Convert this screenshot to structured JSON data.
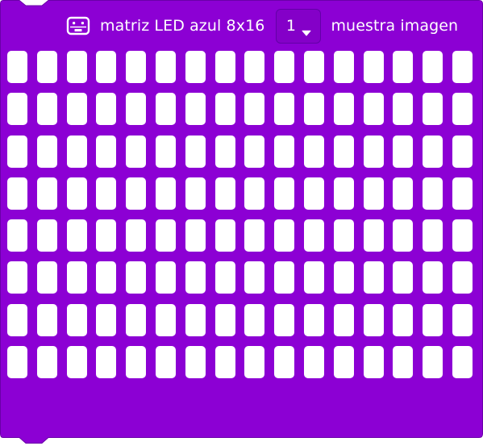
{
  "block": {
    "title": "matriz LED azul 8x16",
    "dropdown_value": "1",
    "trailing_text": "muestra imagen",
    "icon": "robot-board-icon",
    "colors": {
      "block_fill": "#8c00d4",
      "block_border": "#6a00a8",
      "led_off": "#ffffff",
      "led_on": "#1d3fe0"
    }
  },
  "matrix": {
    "rows": 8,
    "cols": 16,
    "cells": [
      [
        0,
        0,
        0,
        0,
        0,
        0,
        0,
        0,
        0,
        0,
        0,
        0,
        0,
        0,
        0,
        0
      ],
      [
        0,
        0,
        0,
        0,
        0,
        0,
        0,
        0,
        0,
        0,
        0,
        0,
        0,
        0,
        0,
        0
      ],
      [
        0,
        0,
        0,
        0,
        0,
        0,
        0,
        0,
        0,
        0,
        0,
        0,
        0,
        0,
        0,
        0
      ],
      [
        0,
        0,
        0,
        0,
        0,
        0,
        0,
        0,
        0,
        0,
        0,
        0,
        0,
        0,
        0,
        0
      ],
      [
        0,
        0,
        0,
        0,
        0,
        0,
        0,
        0,
        0,
        0,
        0,
        0,
        0,
        0,
        0,
        0
      ],
      [
        0,
        0,
        0,
        0,
        0,
        0,
        0,
        0,
        0,
        0,
        0,
        0,
        0,
        0,
        0,
        0
      ],
      [
        0,
        0,
        0,
        0,
        0,
        0,
        0,
        0,
        0,
        0,
        0,
        0,
        0,
        0,
        0,
        0
      ],
      [
        0,
        0,
        0,
        0,
        0,
        0,
        0,
        0,
        0,
        0,
        0,
        0,
        0,
        0,
        0,
        0
      ]
    ]
  }
}
